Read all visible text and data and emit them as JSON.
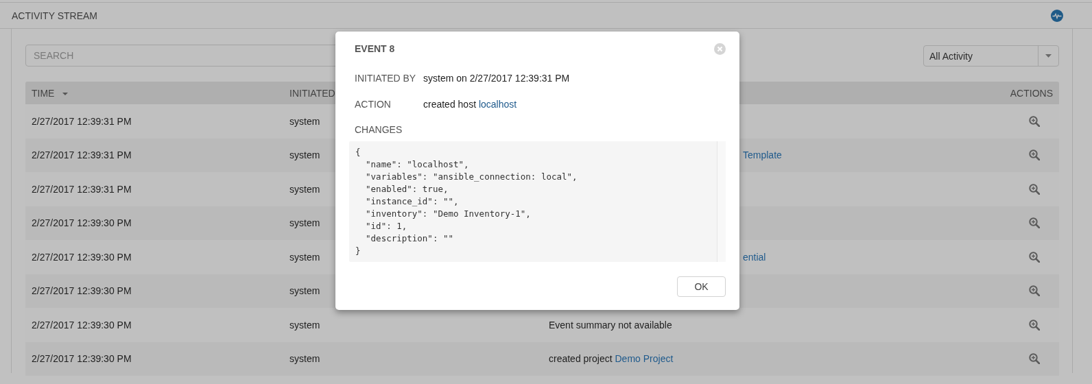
{
  "header": {
    "title": "ACTIVITY STREAM"
  },
  "search": {
    "placeholder": "SEARCH"
  },
  "filter": {
    "value": "All Activity"
  },
  "table": {
    "columns": [
      {
        "label": "TIME",
        "sorted": true
      },
      {
        "label": "INITIATED",
        "sorted": false
      },
      {
        "label": "ACTIONS",
        "sorted": false
      }
    ],
    "rows": [
      {
        "time": "2/27/2017 12:39:31 PM",
        "initiator": "system"
      },
      {
        "time": "2/27/2017 12:39:31 PM",
        "initiator": "system",
        "event": {
          "link": "Template"
        }
      },
      {
        "time": "2/27/2017 12:39:31 PM",
        "initiator": "system"
      },
      {
        "time": "2/27/2017 12:39:30 PM",
        "initiator": "system"
      },
      {
        "time": "2/27/2017 12:39:30 PM",
        "initiator": "system",
        "event": {
          "link": "ential"
        }
      },
      {
        "time": "2/27/2017 12:39:30 PM",
        "initiator": "system"
      },
      {
        "time": "2/27/2017 12:39:30 PM",
        "initiator": "system",
        "event": {
          "text": "Event summary not available"
        }
      },
      {
        "time": "2/27/2017 12:39:30 PM",
        "initiator": "system",
        "event": {
          "text": "created project",
          "link": "Demo Project"
        }
      }
    ]
  },
  "modal": {
    "title": "EVENT 8",
    "fields": [
      {
        "label": "INITIATED BY",
        "text": "system on 2/27/2017 12:39:31 PM"
      },
      {
        "label": "ACTION",
        "text": "created host",
        "link": "localhost"
      }
    ],
    "changes_label": "CHANGES",
    "changes": [
      "{",
      "  \"name\": \"localhost\",",
      "  \"variables\": \"ansible_connection: local\",",
      "  \"enabled\": true,",
      "  \"instance_id\": \"\",",
      "  \"inventory\": \"Demo Inventory-1\",",
      "  \"id\": 1,",
      "  \"description\": \"\"",
      "}"
    ],
    "button": "OK"
  }
}
